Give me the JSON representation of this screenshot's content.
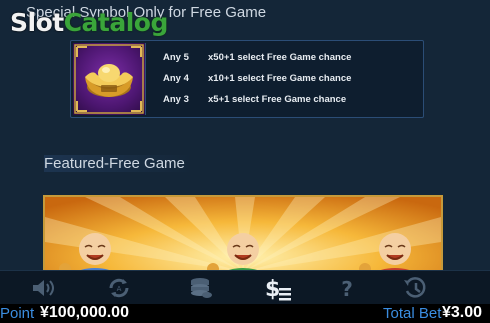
{
  "header": {
    "section_title": "Special Symbol Only for Free Game",
    "logo_slot": "Slot",
    "logo_catalog": "Catalog"
  },
  "special_symbol": {
    "icon": "gold-ingot-icon",
    "payouts": [
      {
        "count": "Any 5",
        "text": "x50+1 select Free Game chance"
      },
      {
        "count": "Any 4",
        "text": "x10+1 select Free Game chance"
      },
      {
        "count": "Any 3",
        "text": "x5+1 select Free Game chance"
      }
    ]
  },
  "featured": {
    "title": "Featured-Free Game",
    "icons": [
      "laughing-buddha-blue-icon",
      "laughing-buddha-green-icon",
      "laughing-buddha-red-icon"
    ]
  },
  "toolbar": {
    "buttons": [
      {
        "icon": "sound-icon"
      },
      {
        "icon": "auto-spin-icon"
      },
      {
        "icon": "coin-stack-icon"
      },
      {
        "icon": "paytable-icon",
        "active": true
      },
      {
        "icon": "help-icon"
      },
      {
        "icon": "history-icon"
      }
    ]
  },
  "status": {
    "point_label": "Point",
    "point_value": "¥100,000.00",
    "bet_label": "Total Bet",
    "bet_value": "¥3.00"
  },
  "colors": {
    "background": "#142638",
    "accent_blue": "#3b8de0",
    "frame_gold": "#c69a3a",
    "logo_green": "#3aa53a"
  }
}
